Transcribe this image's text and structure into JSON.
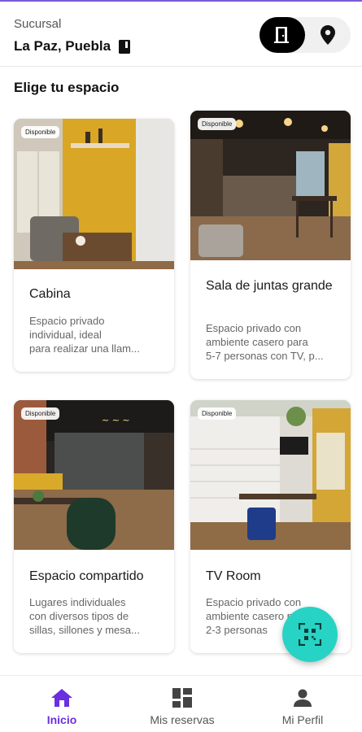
{
  "header": {
    "caption": "Sucursal",
    "branch": "La Paz, Puebla",
    "toggle": {
      "left_icon": "door-icon",
      "right_icon": "location-pin-icon",
      "active": "left"
    }
  },
  "section_title": "Elige tu espacio",
  "spaces": [
    {
      "badge": "Disponible",
      "name": "Cabina",
      "desc": [
        "Espacio privado",
        "individual, ideal",
        "para realizar una llam..."
      ]
    },
    {
      "badge": "Disponible",
      "name": "Sala de juntas grande",
      "desc": [
        "Espacio privado con",
        "ambiente casero para",
        "5-7 personas con TV, p..."
      ]
    },
    {
      "badge": "Disponible",
      "name": "Espacio compartido",
      "desc": [
        "Lugares individuales",
        "con diversos tipos de",
        "sillas, sillones y mesa..."
      ]
    },
    {
      "badge": "Disponible",
      "name": "TV Room",
      "desc": [
        "Espacio privado con",
        "ambiente casero para",
        "2-3 personas"
      ]
    }
  ],
  "fab": {
    "icon": "qr-scan-icon"
  },
  "nav": [
    {
      "label": "Inicio",
      "icon": "home-icon",
      "active": true
    },
    {
      "label": "Mis reservas",
      "icon": "dashboard-icon",
      "active": false
    },
    {
      "label": "Mi Perfil",
      "icon": "person-icon",
      "active": false
    }
  ],
  "colors": {
    "accent": "#6a2fe0",
    "fab": "#27d3c4",
    "toggle_active": "#000000"
  }
}
